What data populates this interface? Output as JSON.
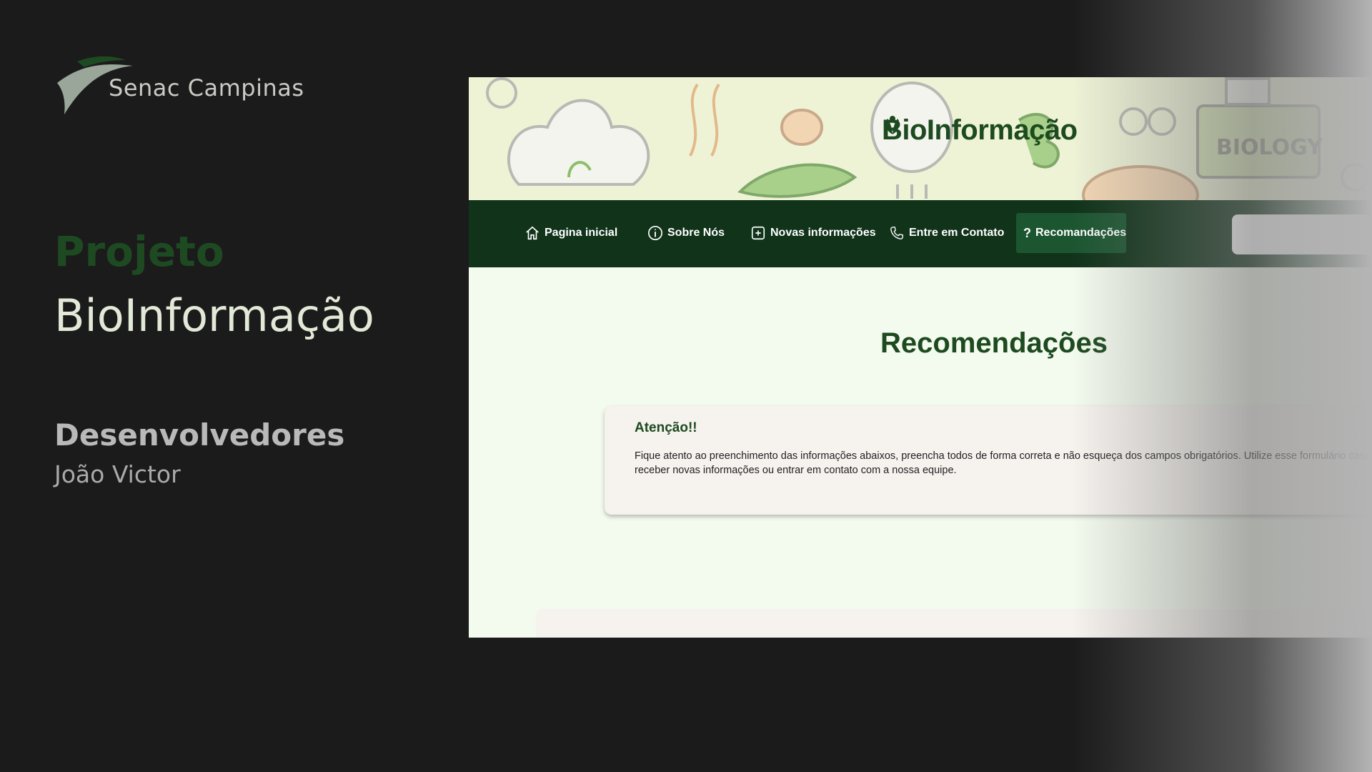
{
  "presentation": {
    "brand_name": "Senac Campinas",
    "project_label": "Projeto",
    "project_title": "BioInformação",
    "developers_label": "Desenvolvedores",
    "developer_name": "João Victor"
  },
  "site": {
    "banner_title": "BioInformação",
    "banner_decoration_text": "BIOLOGY",
    "nav": [
      {
        "label": "Pagina inicial",
        "icon": "home-icon"
      },
      {
        "label": "Sobre Nós",
        "icon": "info-icon"
      },
      {
        "label": "Novas informações",
        "icon": "plus-square-icon"
      },
      {
        "label": "Entre em Contato",
        "icon": "phone-icon"
      },
      {
        "label": "Recomandações",
        "icon": "question-icon",
        "active": true
      }
    ],
    "search_value": "",
    "page_heading": "Recomendações",
    "alert": {
      "title": "Atenção!!",
      "text": "Fique atento ao preenchimento das informações abaixos, preencha todos de forma correta e não esqueça dos campos obrigatórios. Utilize esse formulário caso queria receber novas informações ou entrar em contato com a nossa equipe."
    }
  },
  "colors": {
    "background": "#1b1b1c",
    "brand_green_dark": "#10331a",
    "brand_green": "#1d4a1f",
    "accent_active": "#1c5631",
    "banner_bg": "#eef3d6",
    "page_bg": "#f3faee"
  }
}
